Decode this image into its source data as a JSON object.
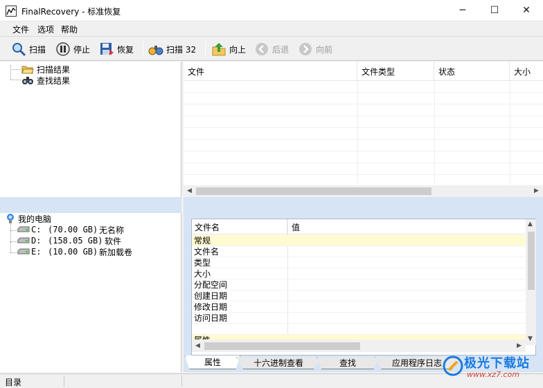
{
  "window": {
    "title": "FinalRecovery - 标准恢复",
    "minimize": "─",
    "maximize": "☐",
    "close": "✕"
  },
  "menu": {
    "items": [
      "文件",
      "选项",
      "帮助"
    ]
  },
  "toolbar": {
    "scan": "扫描",
    "stop": "停止",
    "restore": "恢复",
    "scan32": "扫描 32",
    "up": "向上",
    "back": "后退",
    "forward": "向前"
  },
  "results_tree": {
    "scan_results": "扫描结果",
    "search_results": "查找结果"
  },
  "file_list": {
    "columns": [
      "文件",
      "文件类型",
      "状态",
      "大小"
    ],
    "rows": []
  },
  "drive_tree": {
    "root": "我的电脑",
    "drives": [
      {
        "letter": "C:",
        "size": "(70.00 GB)",
        "label": "无名称"
      },
      {
        "letter": "D:",
        "size": "(158.05 GB)",
        "label": "软件"
      },
      {
        "letter": "E:",
        "size": "(10.00 GB)",
        "label": "新加载卷"
      }
    ]
  },
  "properties": {
    "columns": [
      "文件名",
      "值"
    ],
    "rows": [
      {
        "label": "常规",
        "group": true
      },
      {
        "label": "文件名",
        "group": false
      },
      {
        "label": "类型",
        "group": false
      },
      {
        "label": "大小",
        "group": false
      },
      {
        "label": "分配空间",
        "group": false
      },
      {
        "label": "创建日期",
        "group": false
      },
      {
        "label": "修改日期",
        "group": false
      },
      {
        "label": "访问日期",
        "group": false
      },
      {
        "label": "",
        "group": false
      },
      {
        "label": "属性",
        "group": true
      }
    ]
  },
  "tabs": [
    "属性",
    "十六进制查看",
    "查找",
    "应用程序日志"
  ],
  "status": {
    "text": "目录"
  },
  "watermark": {
    "title": "极光下载站",
    "url": "www.xz7.com"
  },
  "colors": {
    "accent_blue": "#d6e4f5",
    "group_row": "#fffbd0",
    "watermark_blue": "#1b7be0"
  }
}
